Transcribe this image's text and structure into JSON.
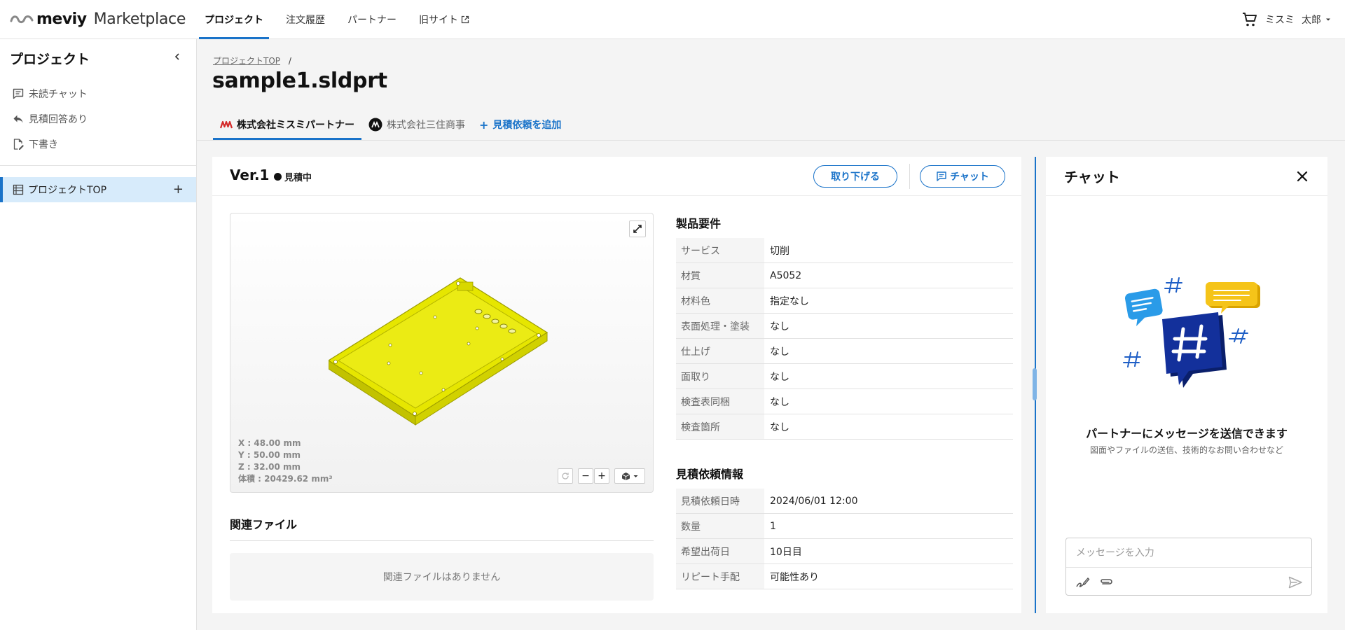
{
  "header": {
    "brand": "meviy",
    "brand_sub": "Marketplace",
    "nav": [
      {
        "label": "プロジェクト",
        "active": true
      },
      {
        "label": "注文履歴"
      },
      {
        "label": "パートナー"
      },
      {
        "label": "旧サイト"
      }
    ],
    "company": "ミスミ",
    "user": "太郎",
    "icons": {
      "cart": "cart-icon",
      "external": "external-link-icon",
      "user_menu": "chevron-down-icon"
    }
  },
  "sidebar": {
    "title": "プロジェクト",
    "items": [
      {
        "label": "未読チャット",
        "icon": "chat-icon"
      },
      {
        "label": "見積回答あり",
        "icon": "reply-icon"
      },
      {
        "label": "下書き",
        "icon": "draft-icon"
      }
    ],
    "project": {
      "label": "プロジェクトTOP",
      "icon": "list-icon"
    },
    "add_symbol": "+"
  },
  "main": {
    "breadcrumb": {
      "link": "プロジェクトTOP",
      "sep": "/"
    },
    "title": "sample1.sldprt",
    "tabs": [
      {
        "label": "株式会社ミスミパートナー",
        "active": true
      },
      {
        "label": "株式会社三住商事"
      },
      {
        "label": "見積依頼を追加",
        "prefix": "+"
      }
    ],
    "version": {
      "label": "Ver.1",
      "status": "見積中"
    },
    "buttons": {
      "withdraw": "取り下げる",
      "chat": "チャット"
    },
    "viewer": {
      "x": "X : 48.00 mm",
      "y": "Y : 50.00 mm",
      "z": "Z : 32.00 mm",
      "volume": "体積 : 20429.62 mm³",
      "zoom_out": "−",
      "zoom_in": "+",
      "model_color": "#e8e800"
    },
    "related": {
      "title": "関連ファイル",
      "empty": "関連ファイルはありません"
    },
    "requirements": {
      "title": "製品要件",
      "rows": [
        {
          "k": "サービス",
          "v": "切削"
        },
        {
          "k": "材質",
          "v": "A5052"
        },
        {
          "k": "材料色",
          "v": "指定なし"
        },
        {
          "k": "表面処理・塗装",
          "v": "なし"
        },
        {
          "k": "仕上げ",
          "v": "なし"
        },
        {
          "k": "面取り",
          "v": "なし"
        },
        {
          "k": "検査表同梱",
          "v": "なし"
        },
        {
          "k": "検査箇所",
          "v": "なし"
        }
      ]
    },
    "quote": {
      "title": "見積依頼情報",
      "rows": [
        {
          "k": "見積依頼日時",
          "v": "2024/06/01 12:00"
        },
        {
          "k": "数量",
          "v": "1"
        },
        {
          "k": "希望出荷日",
          "v": "10日目"
        },
        {
          "k": "リピート手配",
          "v": "可能性あり"
        }
      ]
    }
  },
  "chat": {
    "title": "チャット",
    "message": "パートナーにメッセージを送信できます",
    "sub": "図面やファイルの送信、技術的なお問い合わせなど",
    "placeholder": "メッセージを入力"
  },
  "colors": {
    "accent": "#1a73c9",
    "selected_bg": "#d7ebfb",
    "navy": "#0d2a8a",
    "speech_blue": "#2a9be8",
    "speech_yellow": "#f5c419"
  }
}
